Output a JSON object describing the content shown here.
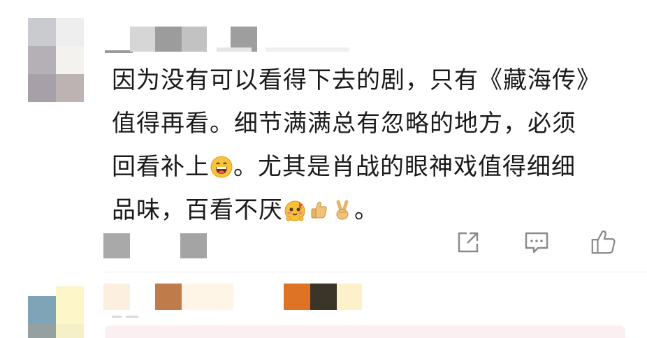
{
  "comment_1": {
    "lines": [
      "因为没有可以看得下去的剧，只有《藏海传》",
      "值得再看。细节满满总有忽略的地方，必须",
      "回看补上",
      "。尤其是肖战的眼神戏值得细细",
      "品味，百看不厌",
      "。"
    ],
    "emojis": [
      "grinning-face-emoji",
      "blushing-cute-face-emoji",
      "thumbs-up-emoji",
      "victory-hand-emoji"
    ],
    "actions": {
      "share_icon": "share-icon",
      "comment_icon": "comment-icon",
      "like_icon": "thumbs-up-icon"
    }
  },
  "colors": {
    "text": "#1a1a1a",
    "icon": "#8a8a8a",
    "divider": "#ececec"
  }
}
